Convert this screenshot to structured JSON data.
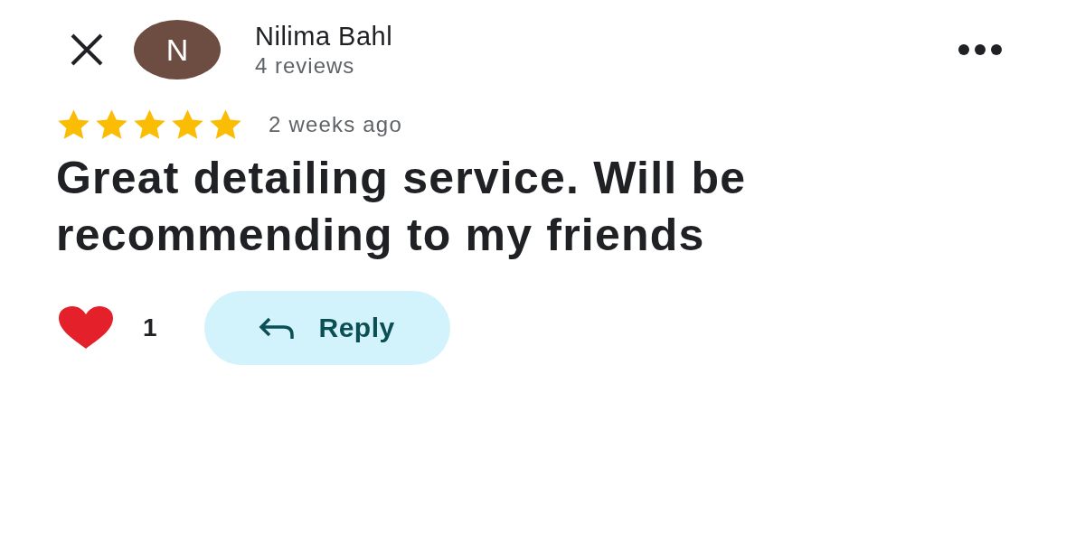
{
  "reviewer": {
    "initial": "N",
    "name": "Nilima Bahl",
    "review_count": "4 reviews"
  },
  "rating": {
    "stars": 5,
    "time": "2 weeks ago"
  },
  "review_text": "Great detailing service. Will be recommending to my friends",
  "reactions": {
    "liked": true,
    "count": "1"
  },
  "reply_button": {
    "label": "Reply"
  }
}
